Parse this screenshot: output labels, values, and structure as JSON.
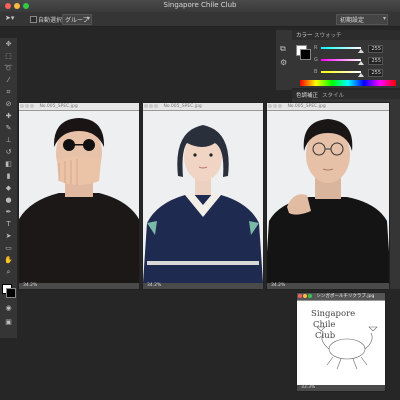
{
  "window": {
    "title": "Singapore Chile Club"
  },
  "options_bar": {
    "auto_select_label": "自動選択",
    "group_select": "グループ",
    "workspace_select": "初期設定"
  },
  "tools": [
    "move-tool",
    "marquee-tool",
    "lasso-tool",
    "magic-wand-tool",
    "crop-tool",
    "eyedropper-tool",
    "healing-tool",
    "brush-tool",
    "stamp-tool",
    "history-brush-tool",
    "eraser-tool",
    "gradient-tool",
    "blur-tool",
    "dodge-tool",
    "pen-tool",
    "type-tool",
    "path-select-tool",
    "shape-tool",
    "hand-tool",
    "zoom-tool"
  ],
  "color_panel": {
    "tabs": [
      "カラー",
      "スウォッチ"
    ],
    "channels": [
      {
        "label": "R",
        "value": "255"
      },
      {
        "label": "G",
        "value": "255"
      },
      {
        "label": "B",
        "value": "255"
      }
    ]
  },
  "adjust_panel": {
    "tabs": [
      "色調補正",
      "スタイル"
    ]
  },
  "documents": [
    {
      "title": "No.005_SPEC.jpg",
      "zoom": "34.2%"
    },
    {
      "title": "No.005_SPEC.jpg",
      "zoom": "34.2%"
    },
    {
      "title": "No.005_SPEC.jpg",
      "zoom": "34.2%"
    },
    {
      "title": "シンガポールチリクラブ.jpg",
      "zoom": "33.3%"
    }
  ],
  "logo_text": [
    "Singapore",
    "Chile",
    "Club"
  ],
  "colors": {
    "close": "#fc605b",
    "minimize": "#fdbc40",
    "maximize": "#34c84a",
    "workspace": "#262626",
    "panel": "#353535"
  }
}
